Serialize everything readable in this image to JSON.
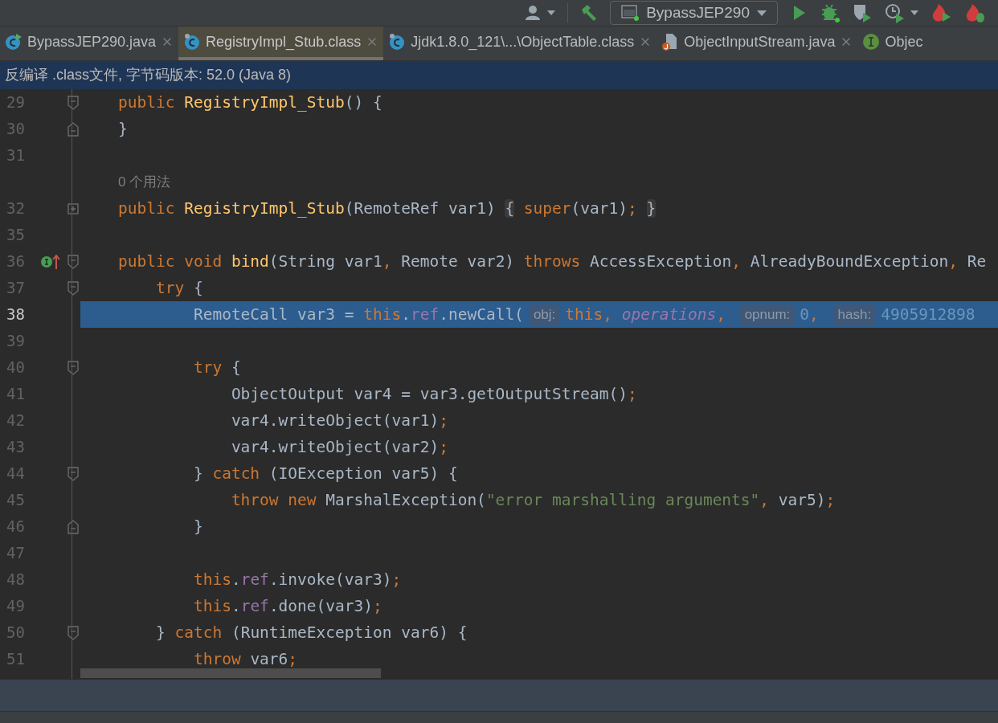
{
  "toolbar": {
    "run_config": "BypassJEP290"
  },
  "tabs": [
    {
      "label": "BypassJEP290.java",
      "kind": "runnable-class",
      "selected": false,
      "closable": true
    },
    {
      "label": "RegistryImpl_Stub.class",
      "kind": "class",
      "selected": true,
      "closable": true
    },
    {
      "label": "Jjdk1.8.0_121\\...\\ObjectTable.class",
      "kind": "class",
      "selected": false,
      "closable": true
    },
    {
      "label": "ObjectInputStream.java",
      "kind": "java",
      "selected": false,
      "closable": true
    },
    {
      "label": "Objec",
      "kind": "interface",
      "selected": false,
      "closable": false
    }
  ],
  "banner": "反编译 .class文件, 字节码版本: 52.0 (Java 8)",
  "editor": {
    "lines": [
      {
        "kind": "code",
        "number": "29",
        "fold_start": true,
        "tokens": [
          {
            "kind": "kw",
            "text": "public "
          },
          {
            "kind": "fn",
            "text": "RegistryImpl_Stub"
          },
          {
            "kind": "plain",
            "text": "() {"
          }
        ]
      },
      {
        "kind": "code",
        "number": "30",
        "fold_end": true,
        "tokens": [
          {
            "kind": "plain",
            "text": "}"
          }
        ]
      },
      {
        "kind": "code",
        "number": "31"
      },
      {
        "kind": "usage",
        "text": "0 个用法"
      },
      {
        "kind": "code",
        "number": "32",
        "collapsed": true,
        "tokens": [
          {
            "kind": "kw",
            "text": "public "
          },
          {
            "kind": "fn",
            "text": "RegistryImpl_Stub"
          },
          {
            "kind": "plain",
            "text": "(RemoteRef var1) "
          },
          {
            "kind": "folded",
            "text": "{"
          },
          {
            "kind": "kw",
            "text": " super"
          },
          {
            "kind": "plain",
            "text": "(var1)"
          },
          {
            "kind": "kw",
            "text": "; "
          },
          {
            "kind": "folded",
            "text": "}"
          }
        ]
      },
      {
        "kind": "code",
        "number": "35"
      },
      {
        "kind": "code",
        "number": "36",
        "fold_start": true,
        "implements": true,
        "tokens": [
          {
            "kind": "kw",
            "text": "public void "
          },
          {
            "kind": "fn",
            "text": "bind"
          },
          {
            "kind": "plain",
            "text": "(String var1"
          },
          {
            "kind": "kw",
            "text": ", "
          },
          {
            "kind": "plain",
            "text": "Remote var2) "
          },
          {
            "kind": "kw",
            "text": "throws "
          },
          {
            "kind": "plain",
            "text": "AccessException"
          },
          {
            "kind": "kw",
            "text": ", "
          },
          {
            "kind": "plain",
            "text": "AlreadyBoundException"
          },
          {
            "kind": "kw",
            "text": ", "
          },
          {
            "kind": "plain",
            "text": "Re"
          }
        ]
      },
      {
        "kind": "code",
        "number": "37",
        "fold_start": true,
        "tokens": [
          {
            "kind": "kw",
            "text": "    try"
          },
          {
            "kind": "plain",
            "text": " {"
          }
        ]
      },
      {
        "kind": "code",
        "number": "38",
        "selected": true,
        "tokens": [
          {
            "kind": "plain",
            "text": "        RemoteCall var3 = "
          },
          {
            "kind": "kw",
            "text": "this"
          },
          {
            "kind": "plain",
            "text": "."
          },
          {
            "kind": "field",
            "text": "ref"
          },
          {
            "kind": "plain",
            "text": ".newCall("
          },
          {
            "kind": "hint",
            "text": "obj:"
          },
          {
            "kind": "kw",
            "text": "this, "
          },
          {
            "kind": "static",
            "text": "operations"
          },
          {
            "kind": "kw",
            "text": ", "
          },
          {
            "kind": "hint",
            "text": "opnum:"
          },
          {
            "kind": "num",
            "text": "0"
          },
          {
            "kind": "kw",
            "text": ", "
          },
          {
            "kind": "hint",
            "text": "hash:"
          },
          {
            "kind": "num",
            "text": "4905912898"
          }
        ]
      },
      {
        "kind": "code",
        "number": "39"
      },
      {
        "kind": "code",
        "number": "40",
        "fold_start": true,
        "tokens": [
          {
            "kind": "kw",
            "text": "        try"
          },
          {
            "kind": "plain",
            "text": " {"
          }
        ]
      },
      {
        "kind": "code",
        "number": "41",
        "tokens": [
          {
            "kind": "plain",
            "text": "            ObjectOutput var4 = var3.getOutputStream()"
          },
          {
            "kind": "kw",
            "text": ";"
          }
        ]
      },
      {
        "kind": "code",
        "number": "42",
        "tokens": [
          {
            "kind": "plain",
            "text": "            var4.writeObject(var1)"
          },
          {
            "kind": "kw",
            "text": ";"
          }
        ]
      },
      {
        "kind": "code",
        "number": "43",
        "tokens": [
          {
            "kind": "plain",
            "text": "            var4.writeObject(var2)"
          },
          {
            "kind": "kw",
            "text": ";"
          }
        ]
      },
      {
        "kind": "code",
        "number": "44",
        "fold_start": true,
        "tokens": [
          {
            "kind": "plain",
            "text": "        } "
          },
          {
            "kind": "kw",
            "text": "catch"
          },
          {
            "kind": "plain",
            "text": " (IOException var5) {"
          }
        ]
      },
      {
        "kind": "code",
        "number": "45",
        "tokens": [
          {
            "kind": "kw",
            "text": "            throw new "
          },
          {
            "kind": "plain",
            "text": "MarshalException("
          },
          {
            "kind": "str",
            "text": "\"error marshalling arguments\""
          },
          {
            "kind": "kw",
            "text": ", "
          },
          {
            "kind": "plain",
            "text": "var5)"
          },
          {
            "kind": "kw",
            "text": ";"
          }
        ]
      },
      {
        "kind": "code",
        "number": "46",
        "fold_end": true,
        "tokens": [
          {
            "kind": "plain",
            "text": "        }"
          }
        ]
      },
      {
        "kind": "code",
        "number": "47"
      },
      {
        "kind": "code",
        "number": "48",
        "tokens": [
          {
            "kind": "kw",
            "text": "        this"
          },
          {
            "kind": "plain",
            "text": "."
          },
          {
            "kind": "field",
            "text": "ref"
          },
          {
            "kind": "plain",
            "text": ".invoke(var3)"
          },
          {
            "kind": "kw",
            "text": ";"
          }
        ]
      },
      {
        "kind": "code",
        "number": "49",
        "tokens": [
          {
            "kind": "kw",
            "text": "        this"
          },
          {
            "kind": "plain",
            "text": "."
          },
          {
            "kind": "field",
            "text": "ref"
          },
          {
            "kind": "plain",
            "text": ".done(var3)"
          },
          {
            "kind": "kw",
            "text": ";"
          }
        ]
      },
      {
        "kind": "code",
        "number": "50",
        "fold_start": true,
        "tokens": [
          {
            "kind": "plain",
            "text": "    } "
          },
          {
            "kind": "kw",
            "text": "catch"
          },
          {
            "kind": "plain",
            "text": " (RuntimeException var6) {"
          }
        ]
      },
      {
        "kind": "code",
        "number": "51",
        "tokens": [
          {
            "kind": "kw",
            "text": "        throw "
          },
          {
            "kind": "plain",
            "text": "var6"
          },
          {
            "kind": "kw",
            "text": ";"
          }
        ]
      }
    ]
  }
}
